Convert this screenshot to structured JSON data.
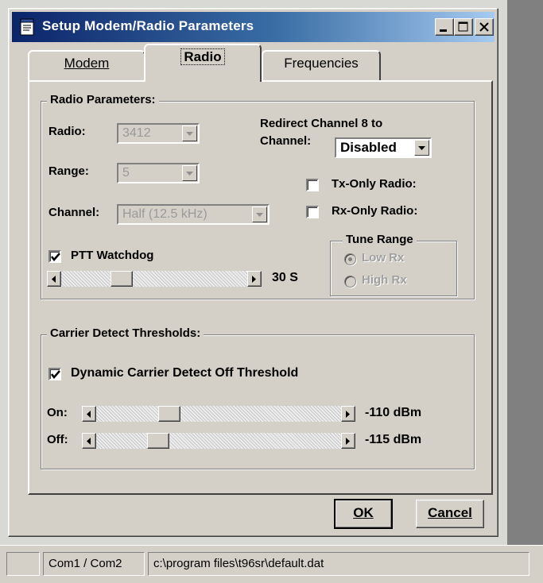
{
  "window": {
    "title": "Setup Modem/Radio Parameters",
    "icon": "notepad-icon"
  },
  "tabs": [
    {
      "label": "Modem",
      "selected": false
    },
    {
      "label": "Radio",
      "selected": true
    },
    {
      "label": "Frequencies",
      "selected": false
    }
  ],
  "radio_params": {
    "group_title": "Radio Parameters:",
    "radio_label": "Radio:",
    "radio_value": "3412",
    "range_label": "Range:",
    "range_value": "5",
    "channel_label": "Channel:",
    "channel_value": "Half (12.5 kHz)",
    "redirect_label_line1": "Redirect Channel 8 to",
    "redirect_label_line2": "Channel:",
    "redirect_value": "Disabled",
    "tx_only_label": "Tx-Only Radio:",
    "tx_only_checked": false,
    "rx_only_label": "Rx-Only Radio:",
    "rx_only_checked": false,
    "ptt_label": "PTT Watchdog",
    "ptt_checked": true,
    "ptt_value": "30 S",
    "ptt_slider_fraction": 0.3
  },
  "tune_range": {
    "title": "Tune Range",
    "options": [
      "Low Rx",
      "High Rx"
    ],
    "selected": "Low Rx",
    "enabled": false
  },
  "carrier": {
    "group_title": "Carrier Detect Thresholds:",
    "dynamic_label": "Dynamic Carrier Detect Off Threshold",
    "dynamic_checked": true,
    "on_label": "On:",
    "on_value": "-110 dBm",
    "on_slider_fraction": 0.28,
    "off_label": "Off:",
    "off_value": "-115 dBm",
    "off_slider_fraction": 0.23
  },
  "buttons": {
    "ok": "OK",
    "cancel": "Cancel"
  },
  "statusbar": {
    "pane1": "",
    "pane2": "Com1 / Com2",
    "pane3": "c:\\program files\\t96sr\\default.dat"
  },
  "colors": {
    "title_gradient_start": "#0c246a",
    "title_gradient_end": "#a6caf0",
    "face": "#d4d0c8"
  }
}
